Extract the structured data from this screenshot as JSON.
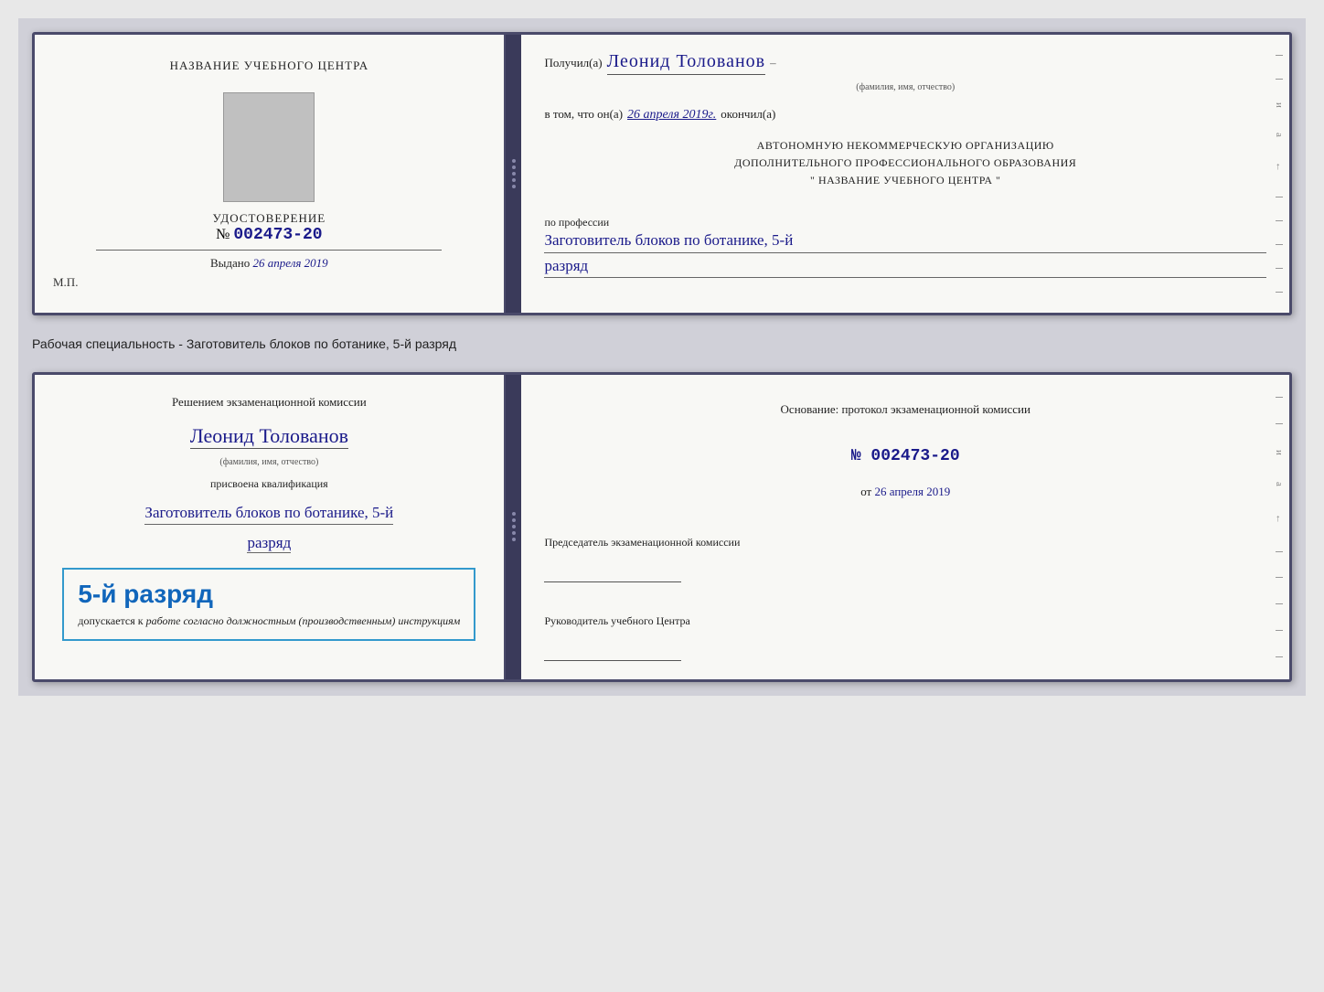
{
  "page": {
    "background": "#d0d0d8"
  },
  "top_document": {
    "left": {
      "school_title": "НАЗВАНИЕ УЧЕБНОГО ЦЕНТРА",
      "cert_label": "УДОСТОВЕРЕНИЕ",
      "cert_number_prefix": "№",
      "cert_number": "002473-20",
      "issued_label": "Выдано",
      "issued_date": "26 апреля 2019",
      "mp_label": "М.П."
    },
    "right": {
      "received_label": "Получил(а)",
      "recipient_name": "Леонид Толованов",
      "name_hint": "(фамилия, имя, отчество)",
      "dash": "–",
      "in_that_label": "в том, что он(а)",
      "completed_date": "26 апреля 2019г.",
      "completed_label": "окончил(а)",
      "org_line1": "АВТОНОМНУЮ НЕКОММЕРЧЕСКУЮ ОРГАНИЗАЦИЮ",
      "org_line2": "ДОПОЛНИТЕЛЬНОГО ПРОФЕССИОНАЛЬНОГО ОБРАЗОВАНИЯ",
      "org_line3": "\" НАЗВАНИЕ УЧЕБНОГО ЦЕНТРА \"",
      "profession_label": "по профессии",
      "profession_name": "Заготовитель блоков по ботанике, 5-й",
      "rank": "разряд"
    }
  },
  "specialty_label": "Рабочая специальность - Заготовитель блоков по ботанике, 5-й разряд",
  "bottom_document": {
    "left": {
      "commission_intro": "Решением экзаменационной комиссии",
      "person_name": "Леонид Толованов",
      "name_hint": "(фамилия, имя, отчество)",
      "assigned_label": "присвоена квалификация",
      "qualification": "Заготовитель блоков по ботанике, 5-й",
      "rank": "разряд",
      "rank_box_text": "5-й разряд",
      "allowed_label": "допускается к",
      "allowed_italic": "работе согласно должностным (производственным) инструкциям"
    },
    "right": {
      "basis_label": "Основание: протокол экзаменационной комиссии",
      "protocol_number": "№  002473-20",
      "date_from_prefix": "от",
      "date_from": "26 апреля 2019",
      "chairman_label": "Председатель экзаменационной комиссии",
      "director_label": "Руководитель учебного Центра"
    }
  }
}
